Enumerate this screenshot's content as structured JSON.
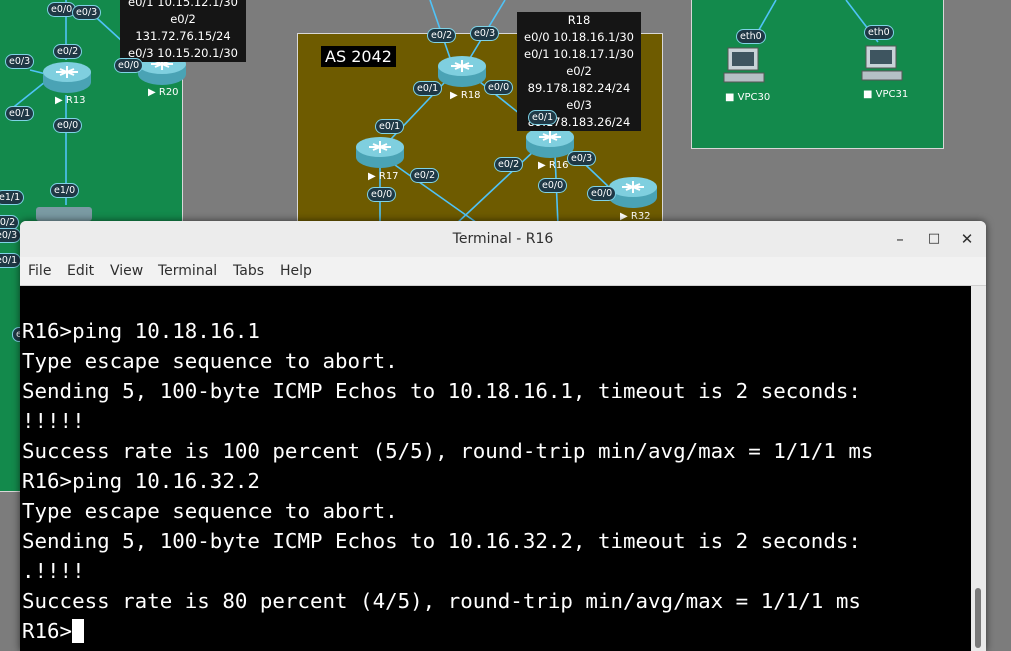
{
  "topology": {
    "zone_label": "AS 2042",
    "routers": {
      "r13": "R13",
      "r20": "R20",
      "r18": "R18",
      "r17": "R17",
      "r16": "R16",
      "r32": "R32"
    },
    "pcs": {
      "vpc30": "VPC30",
      "vpc31": "VPC31"
    },
    "info_r20": [
      "e0/1 10.15.12.1/30",
      "e0/2 131.72.76.15/24",
      "e0/3 10.15.20.1/30"
    ],
    "info_r18": [
      "R18",
      "e0/0 10.18.16.1/30",
      "e0/1 10.18.17.1/30",
      "e0/2  89.178.182.24/24",
      "e0/3 89.178.183.26/24"
    ],
    "interfaces": {
      "a": "e0/0",
      "b": "e0/3",
      "c": "e0/2",
      "d": "e0/3",
      "e": "e0/0",
      "f": "e0/1",
      "g": "e0/0",
      "h": "e1/0",
      "i": "e1/1",
      "j": "e0/2",
      "k": "e0/3",
      "l": "e0/1",
      "m": "e0/2",
      "n": "e0/3",
      "o": "e0/1",
      "p": "e0/0",
      "q": "e0/1",
      "r": "e0/1",
      "s": "e0/2",
      "t": "e0/0",
      "u": "e0/2",
      "v": "e0/3",
      "w": "e0/0",
      "x": "e0/0",
      "y": "eth0",
      "z": "eth0",
      "aa": "e"
    }
  },
  "terminal": {
    "title": "Terminal - R16",
    "menu": [
      "File",
      "Edit",
      "View",
      "Terminal",
      "Tabs",
      "Help"
    ],
    "controls": {
      "minimize": "–",
      "maximize": "□",
      "close": "✕"
    },
    "lines": [
      "R16>ping 10.18.16.1",
      "Type escape sequence to abort.",
      "Sending 5, 100-byte ICMP Echos to 10.18.16.1, timeout is 2 seconds:",
      "!!!!!",
      "Success rate is 100 percent (5/5), round-trip min/avg/max = 1/1/1 ms",
      "R16>ping 10.16.32.2",
      "Type escape sequence to abort.",
      "Sending 5, 100-byte ICMP Echos to 10.16.32.2, timeout is 2 seconds:",
      ".!!!!",
      "Success rate is 80 percent (4/5), round-trip min/avg/max = 1/1/1 ms"
    ],
    "prompt": "R16>"
  }
}
